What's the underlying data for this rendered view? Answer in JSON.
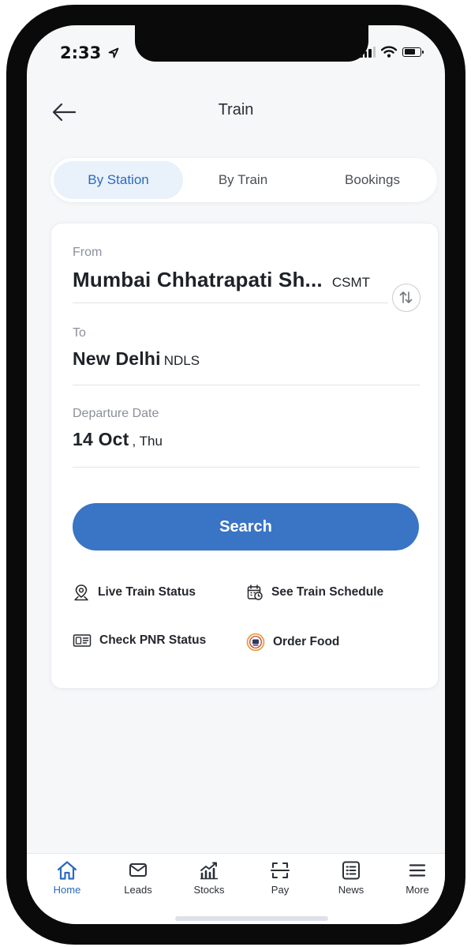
{
  "status_bar": {
    "time": "2:33",
    "location_icon": "location-arrow-icon",
    "signal_icon": "cellular-signal-icon",
    "wifi_icon": "wifi-icon",
    "battery_icon": "battery-icon",
    "battery_level": 0.7
  },
  "header": {
    "title": "Train",
    "back_icon": "arrow-left-icon"
  },
  "tabs": [
    {
      "label": "By Station",
      "active": true
    },
    {
      "label": "By Train",
      "active": false
    },
    {
      "label": "Bookings",
      "active": false
    }
  ],
  "form": {
    "from": {
      "label": "From",
      "value": "Mumbai Chhatrapati Sh...",
      "code": "CSMT"
    },
    "to": {
      "label": "To",
      "value": "New Delhi",
      "code": "NDLS"
    },
    "departure": {
      "label": "Departure Date",
      "value": "14 Oct",
      "suffix": ", Thu"
    },
    "swap_icon": "swap-vertical-icon",
    "search_label": "Search"
  },
  "quick_links": [
    {
      "label": "Live Train Status",
      "icon": "map-pin-icon"
    },
    {
      "label": "See Train Schedule",
      "icon": "calendar-clock-icon"
    },
    {
      "label": "Check PNR Status",
      "icon": "id-card-icon"
    },
    {
      "label": "Order Food",
      "icon": "food-plate-icon"
    }
  ],
  "bottom_nav": [
    {
      "label": "Home",
      "icon": "home-icon",
      "active": true
    },
    {
      "label": "Leads",
      "icon": "mail-icon",
      "active": false
    },
    {
      "label": "Stocks",
      "icon": "stocks-chart-icon",
      "active": false
    },
    {
      "label": "Pay",
      "icon": "scan-icon",
      "active": false
    },
    {
      "label": "News",
      "icon": "news-list-icon",
      "active": false
    },
    {
      "label": "More",
      "icon": "menu-icon",
      "active": false
    }
  ],
  "colors": {
    "accent": "#3a74c5",
    "active_tab_bg": "#e9f1fb",
    "active_text": "#2a6bbf"
  }
}
